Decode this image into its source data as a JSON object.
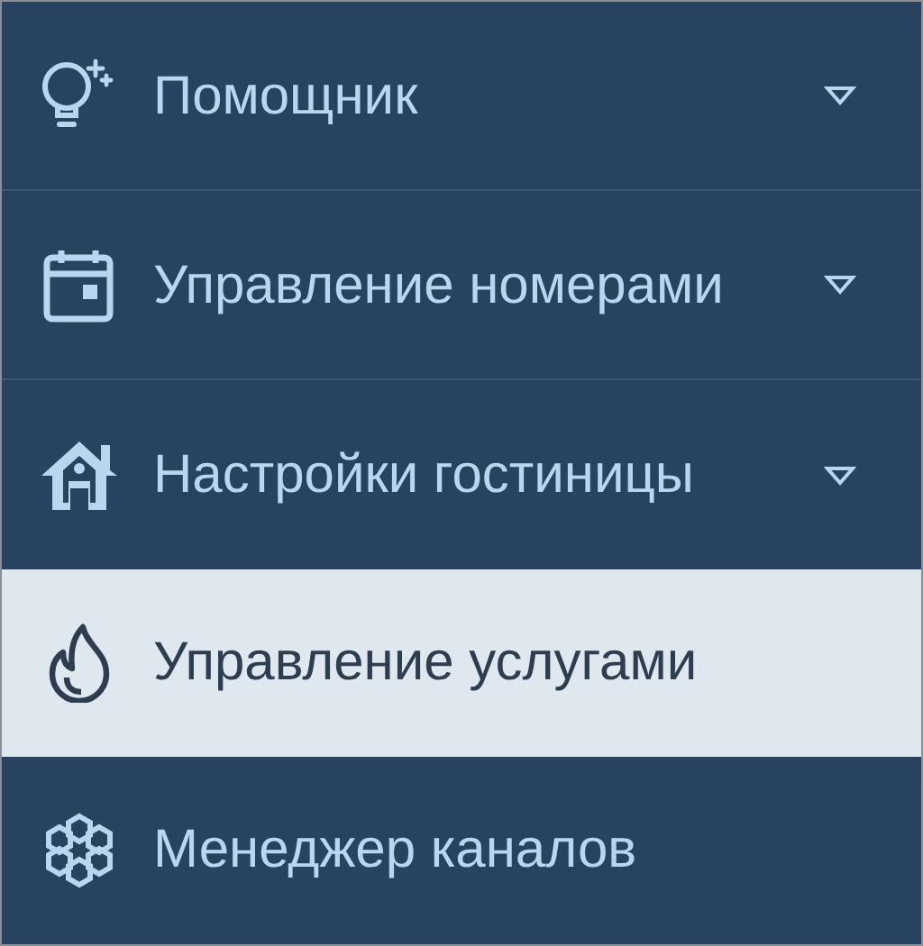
{
  "menu": [
    {
      "label": "Помощник",
      "expanded": false,
      "selected": false
    },
    {
      "label": "Управление номерами",
      "expanded": false,
      "selected": false
    },
    {
      "label": "Настройки гостиницы",
      "expanded": false,
      "selected": false
    },
    {
      "label": "Управление услугами",
      "selected": true
    },
    {
      "label": "Менеджер каналов",
      "selected": false
    }
  ]
}
